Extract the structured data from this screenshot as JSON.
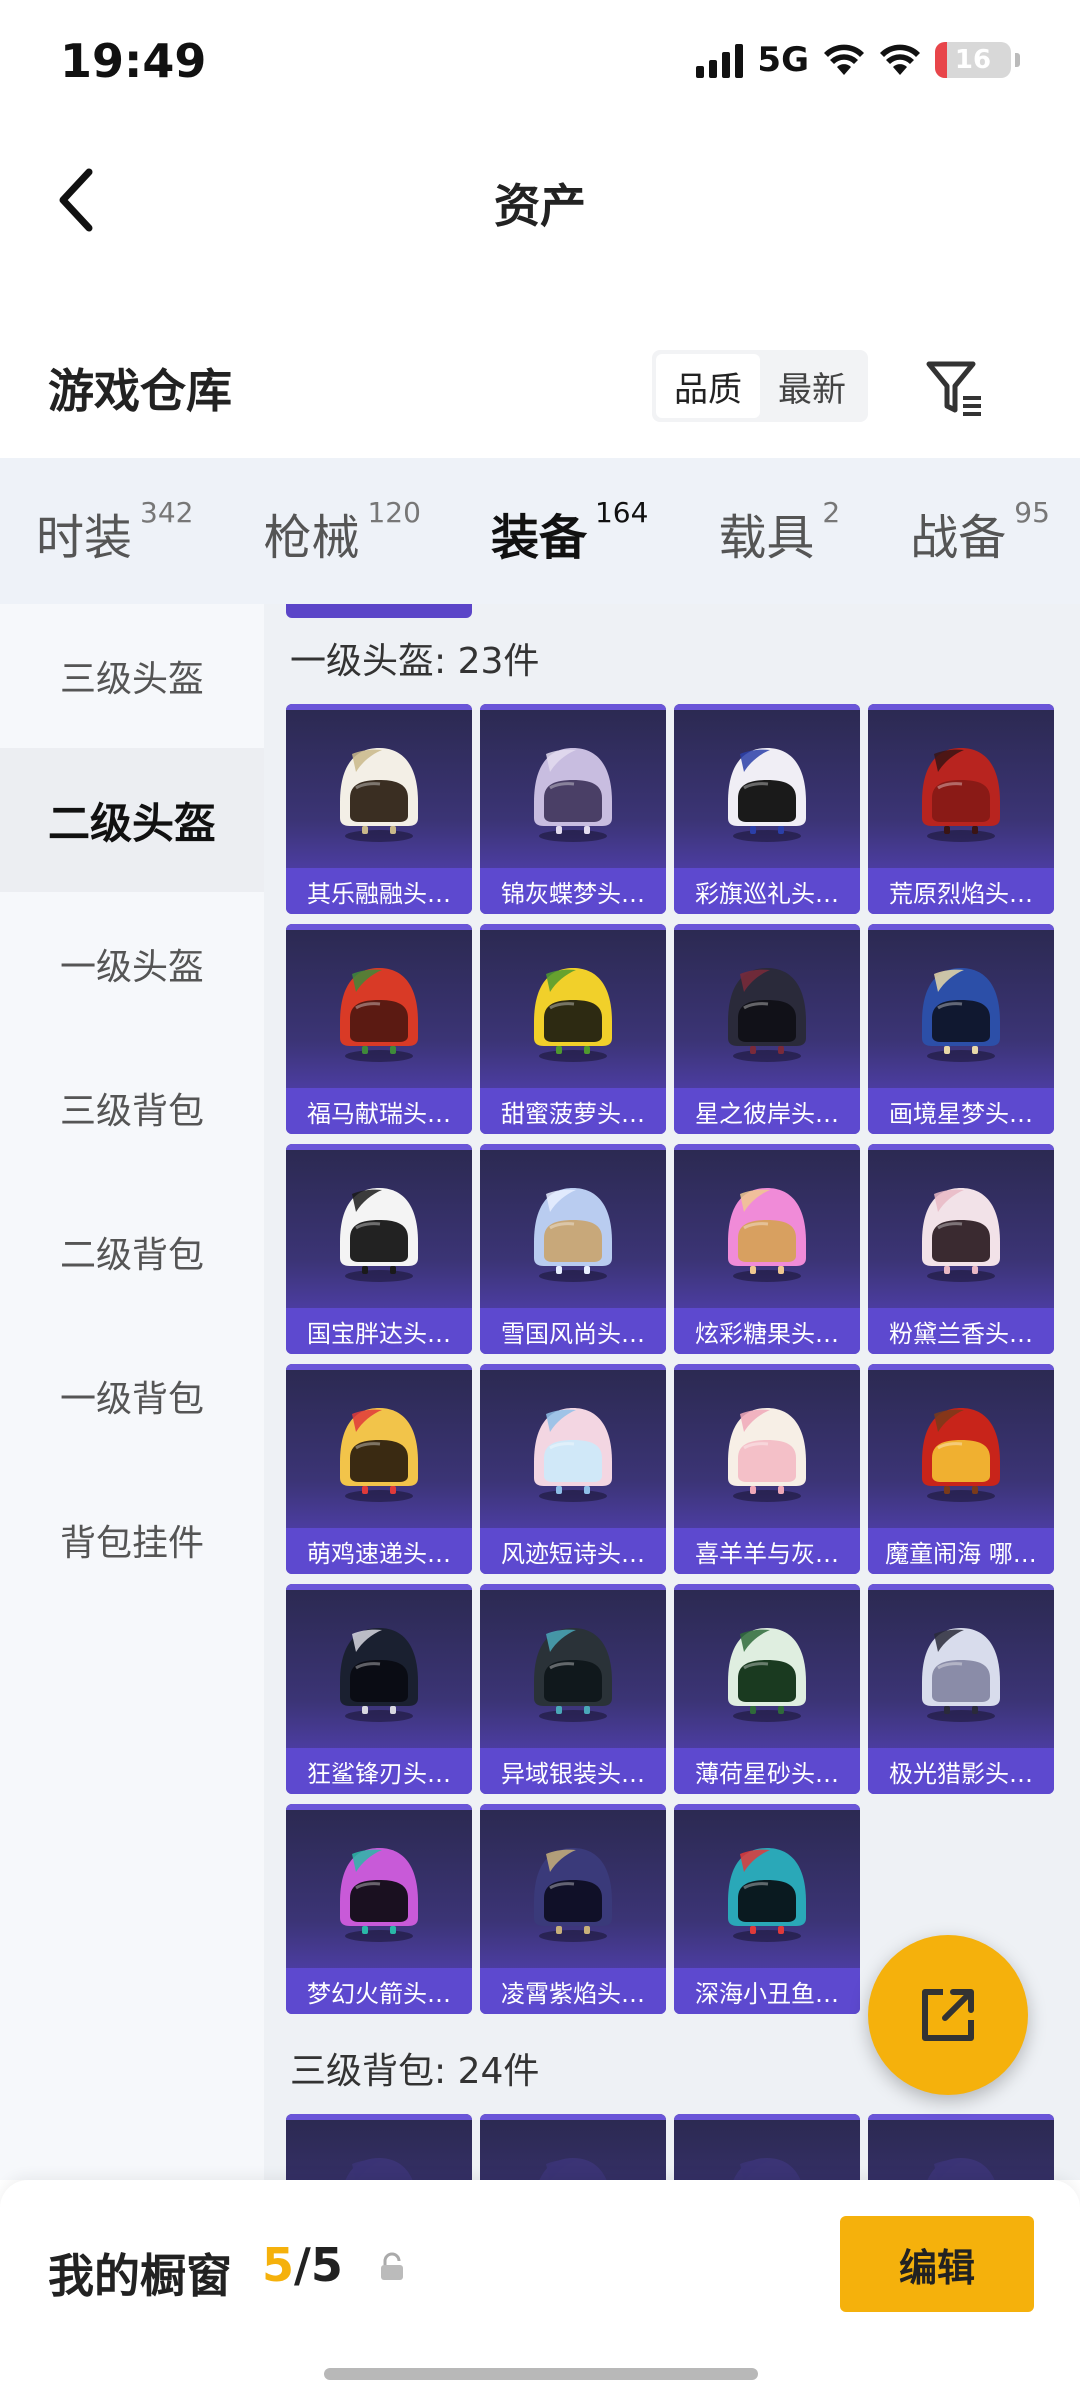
{
  "status_bar": {
    "time": "19:49",
    "network": "5G",
    "battery": "16",
    "battery_level_percent": 16
  },
  "nav": {
    "title": "资产"
  },
  "warehouse": {
    "title": "游戏仓库",
    "sort_options": [
      "品质",
      "最新"
    ],
    "active_sort": 0
  },
  "tabs": [
    {
      "label": "时装",
      "count": "342"
    },
    {
      "label": "枪械",
      "count": "120"
    },
    {
      "label": "装备",
      "count": "164"
    },
    {
      "label": "载具",
      "count": "2"
    },
    {
      "label": "战备",
      "count": "95"
    }
  ],
  "active_tab": 2,
  "sidebar": {
    "items": [
      "三级头盔",
      "二级头盔",
      "一级头盔",
      "三级背包",
      "二级背包",
      "一级背包",
      "背包挂件"
    ],
    "active": 1
  },
  "sections": [
    {
      "title": "一级头盔: 23件",
      "items": [
        {
          "name": "其乐融融头…",
          "colors": [
            "#f3efe6",
            "#c9b88a",
            "#3a2e22"
          ]
        },
        {
          "name": "锦灰蝶梦头…",
          "colors": [
            "#c8bde0",
            "#e3dcef",
            "#4a3f66"
          ]
        },
        {
          "name": "彩旗巡礼头…",
          "colors": [
            "#f0eef5",
            "#2b3fa8",
            "#1a1a1a"
          ]
        },
        {
          "name": "荒原烈焰头…",
          "colors": [
            "#b8241f",
            "#3a1414",
            "#8a1a16"
          ]
        },
        {
          "name": "福马献瑞头…",
          "colors": [
            "#d93a26",
            "#3f8a3a",
            "#5b1a12"
          ]
        },
        {
          "name": "甜蜜菠萝头…",
          "colors": [
            "#f1d02a",
            "#4f9a2f",
            "#2d2a12"
          ]
        },
        {
          "name": "星之彼岸头…",
          "colors": [
            "#2a2a3a",
            "#7a2a3a",
            "#111118"
          ]
        },
        {
          "name": "画境星梦头…",
          "colors": [
            "#2c4fa8",
            "#e8d8a8",
            "#101830"
          ]
        },
        {
          "name": "国宝胖达头…",
          "colors": [
            "#f4f4f4",
            "#1a1a1a",
            "#222222"
          ]
        },
        {
          "name": "雪国风尚头…",
          "colors": [
            "#b9ccf0",
            "#e8efff",
            "#c8a87a"
          ]
        },
        {
          "name": "炫彩糖果头…",
          "colors": [
            "#f08bd8",
            "#f0c890",
            "#d8a060"
          ]
        },
        {
          "name": "粉黛兰香头…",
          "colors": [
            "#f2e2e8",
            "#e9b8c4",
            "#3a2a30"
          ]
        },
        {
          "name": "萌鸡速递头…",
          "colors": [
            "#f2c44a",
            "#e03a3a",
            "#3a2a12"
          ]
        },
        {
          "name": "风迹短诗头…",
          "colors": [
            "#f3d6e2",
            "#8fc0e8",
            "#d0e8f8"
          ]
        },
        {
          "name": "喜羊羊与灰…",
          "colors": [
            "#f7efe6",
            "#f0a8b8",
            "#f4c0c8"
          ]
        },
        {
          "name": "魔童闹海 哪…",
          "colors": [
            "#c8241a",
            "#7a3a1a",
            "#f0b030"
          ]
        },
        {
          "name": "狂鲨锋刃头…",
          "colors": [
            "#1a2030",
            "#d8d8e0",
            "#0a0c14"
          ]
        },
        {
          "name": "异域银装头…",
          "colors": [
            "#2a3238",
            "#4aa8b8",
            "#10181c"
          ]
        },
        {
          "name": "薄荷星砂头…",
          "colors": [
            "#dfeee0",
            "#2f6a3a",
            "#1a3a20"
          ]
        },
        {
          "name": "极光猎影头…",
          "colors": [
            "#d8dcec",
            "#2a2a3a",
            "#8a8ca8"
          ]
        },
        {
          "name": "梦幻火箭头…",
          "colors": [
            "#c85ad8",
            "#2ab8a8",
            "#1a1020"
          ]
        },
        {
          "name": "凌霄紫焰头…",
          "colors": [
            "#3a3a7a",
            "#c8b07a",
            "#101028"
          ]
        },
        {
          "name": "深海小丑鱼…",
          "colors": [
            "#2aa8b8",
            "#e03a3a",
            "#0a1a20"
          ]
        }
      ]
    },
    {
      "title": "三级背包: 24件",
      "items": [
        {
          "name": "",
          "colors": [
            "#3b3475",
            "#3b3475",
            "#3b3475"
          ]
        },
        {
          "name": "",
          "colors": [
            "#3b3475",
            "#3b3475",
            "#3b3475"
          ]
        },
        {
          "name": "",
          "colors": [
            "#3b3475",
            "#3b3475",
            "#3b3475"
          ]
        },
        {
          "name": "",
          "colors": [
            "#3b3475",
            "#3b3475",
            "#3b3475"
          ]
        }
      ]
    }
  ],
  "bottom_bar": {
    "label": "我的橱窗",
    "count_current": "5",
    "count_total": "/5",
    "edit_label": "编辑"
  },
  "theme": {
    "accent": "#f5b10c",
    "card_purple": "#5d49cf",
    "card_dark": "#2b2950"
  }
}
